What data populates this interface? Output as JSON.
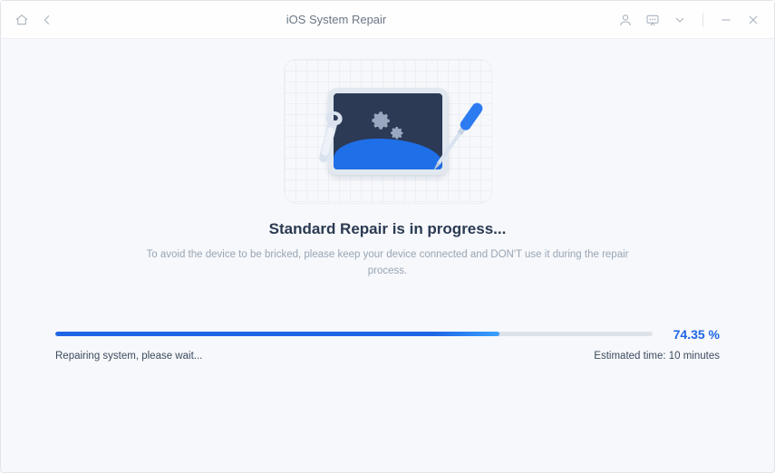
{
  "titlebar": {
    "app_title": "iOS System Repair"
  },
  "main": {
    "heading": "Standard Repair is in progress...",
    "subtext": "To avoid the device to be bricked, please keep your device connected and DON'T use it during the repair process."
  },
  "progress": {
    "percent_label": "74.35 %",
    "percent_value": 74.35,
    "status_text": "Repairing system, please wait...",
    "estimated_label": "Estimated time: 10 minutes"
  },
  "colors": {
    "accent": "#1e66e5",
    "heading": "#2b3a52",
    "muted": "#9aa5b4"
  }
}
